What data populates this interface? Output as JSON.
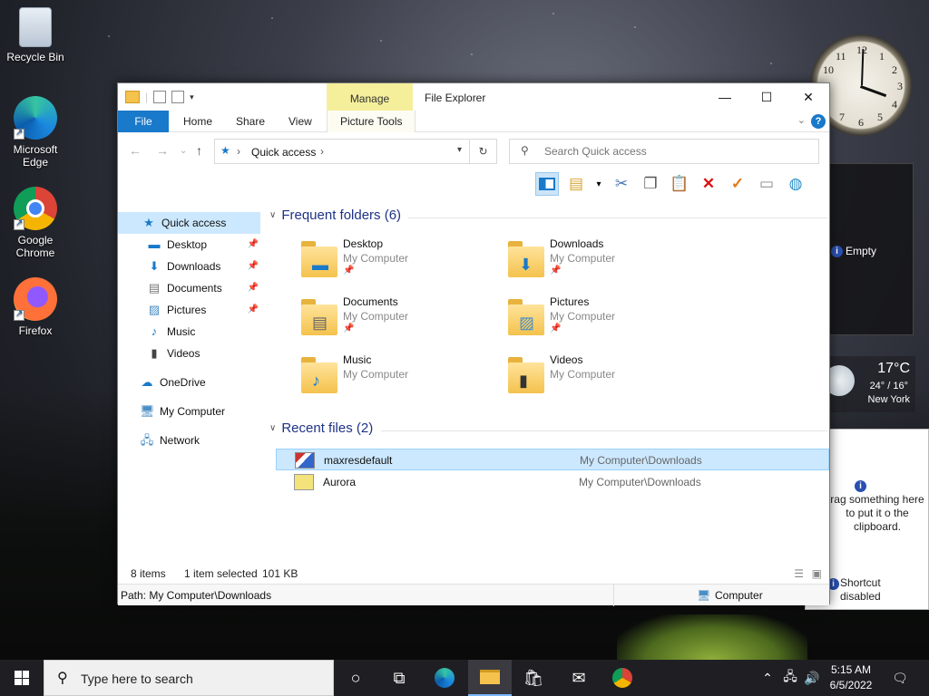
{
  "desktop": {
    "icons": [
      {
        "label": "Recycle Bin"
      },
      {
        "label": "Microsoft Edge"
      },
      {
        "label": "Google Chrome"
      },
      {
        "label": "Firefox"
      }
    ],
    "gadgets": {
      "clock_numbers": [
        "12",
        "1",
        "2",
        "3",
        "4",
        "5",
        "6",
        "7",
        "8",
        "9",
        "10",
        "11"
      ],
      "feed_status": "Empty",
      "weather": {
        "temp": "17°C",
        "range": "24° / 16°",
        "city": "New York"
      },
      "clipboard": {
        "hint": "rag something here to put it o the clipboard.",
        "shortcut": "Shortcut disabled"
      }
    }
  },
  "window": {
    "title": "File Explorer",
    "context_tab": "Manage",
    "tabs": {
      "file": "File",
      "home": "Home",
      "share": "Share",
      "view": "View",
      "picture_tools": "Picture Tools"
    },
    "help": "?",
    "address": {
      "path": "Quick access"
    },
    "search": {
      "placeholder": "Search Quick access"
    },
    "sidebar": {
      "quick_access": "Quick access",
      "items": [
        {
          "label": "Desktop"
        },
        {
          "label": "Downloads"
        },
        {
          "label": "Documents"
        },
        {
          "label": "Pictures"
        },
        {
          "label": "Music"
        },
        {
          "label": "Videos"
        }
      ],
      "onedrive": "OneDrive",
      "my_computer": "My Computer",
      "network": "Network"
    },
    "frequent": {
      "header": "Frequent folders (6)",
      "folders": [
        {
          "name": "Desktop",
          "location": "My Computer"
        },
        {
          "name": "Downloads",
          "location": "My Computer"
        },
        {
          "name": "Documents",
          "location": "My Computer"
        },
        {
          "name": "Pictures",
          "location": "My Computer"
        },
        {
          "name": "Music",
          "location": "My Computer"
        },
        {
          "name": "Videos",
          "location": "My Computer"
        }
      ]
    },
    "recent": {
      "header": "Recent files (2)",
      "files": [
        {
          "name": "maxresdefault",
          "path": "My Computer\\Downloads"
        },
        {
          "name": "Aurora",
          "path": "My Computer\\Downloads"
        }
      ]
    },
    "status": {
      "count": "8 items",
      "selection": "1 item selected",
      "size": "101 KB"
    },
    "pathbar": {
      "path": "Path: My Computer\\Downloads",
      "location": "Computer"
    }
  },
  "taskbar": {
    "search_placeholder": "Type here to search",
    "time": "5:15 AM",
    "date": "6/5/2022"
  },
  "colors": {
    "accent": "#1979ca",
    "selection": "#cce8ff",
    "manage_tab": "#f5ef9b"
  }
}
